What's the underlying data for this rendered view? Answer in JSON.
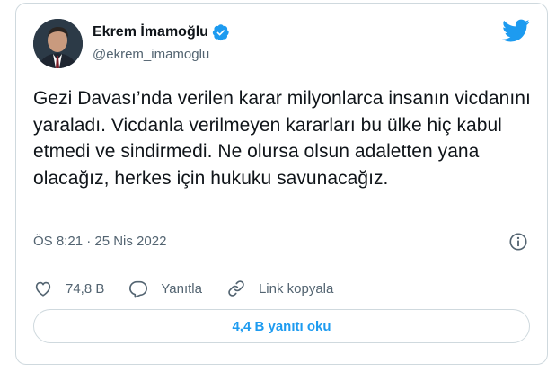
{
  "tweet": {
    "author_name": "Ekrem İmamoğlu",
    "handle": "@ekrem_imamoglu",
    "text": "Gezi Davası’nda verilen karar milyonlarca insanın vicdanını yaraladı. Vicdanla verilmeyen kararları bu ülke hiç kabul etmedi ve sindirmedi. Ne olursa olsun adaletten yana olacağız, herkes için hukuku savunacağız.",
    "timestamp": "ÖS 8:21 · 25 Nis 2022"
  },
  "actions": {
    "likes": "74,8 B",
    "reply_label": "Yanıtla",
    "copy_link_label": "Link kopyala"
  },
  "replies_button": "4,4 B yanıtı oku",
  "icons": {
    "verified": "verified-badge-icon",
    "bird": "twitter-bird-icon",
    "info": "info-icon",
    "like": "heart-icon",
    "reply": "reply-icon",
    "link": "link-icon"
  },
  "colors": {
    "accent": "#1d9bf0",
    "text": "#0f1419",
    "muted": "#536471",
    "border": "#cfd9de"
  }
}
